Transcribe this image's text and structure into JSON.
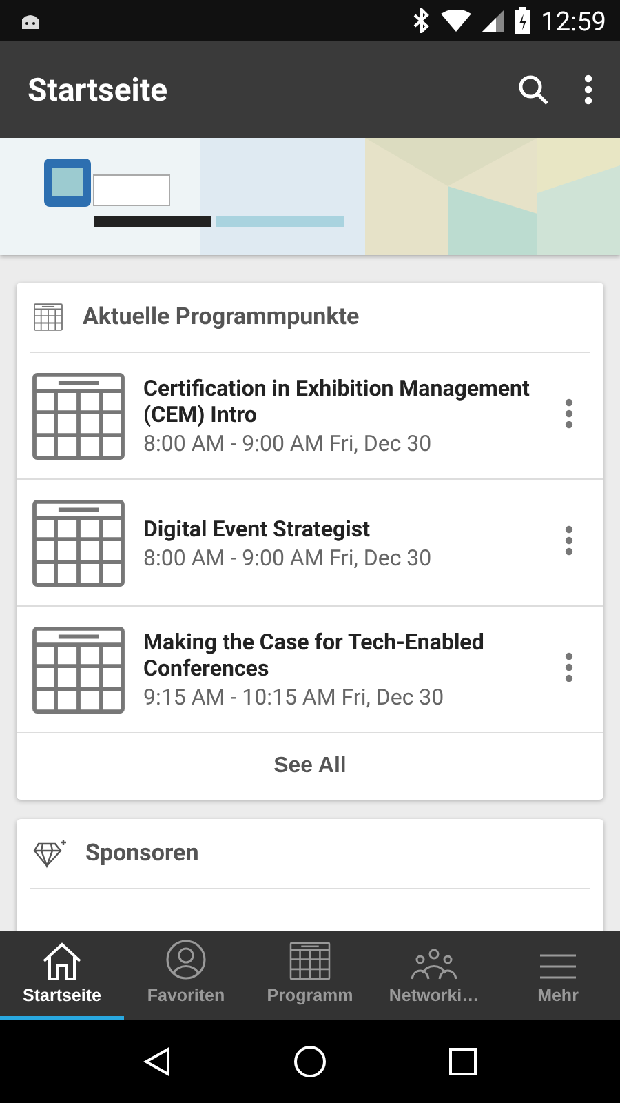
{
  "status_bar": {
    "time": "12:59"
  },
  "app_bar": {
    "title": "Startseite"
  },
  "program_card": {
    "title": "Aktuelle Programmpunkte",
    "sessions": [
      {
        "title": "Certification in Exhibition Management (CEM) Intro",
        "time": "8:00 AM - 9:00 AM Fri, Dec 30"
      },
      {
        "title": "Digital Event Strategist",
        "time": "8:00 AM - 9:00 AM Fri, Dec 30"
      },
      {
        "title": "Making the Case for Tech-Enabled Conferences",
        "time": "9:15 AM - 10:15 AM Fri, Dec 30"
      }
    ],
    "see_all": "See All"
  },
  "sponsors_card": {
    "title": "Sponsoren"
  },
  "bottom_nav": [
    {
      "label": "Startseite",
      "kind": "home",
      "selected": true
    },
    {
      "label": "Favoriten",
      "kind": "person",
      "selected": false
    },
    {
      "label": "Programm",
      "kind": "calendar",
      "selected": false
    },
    {
      "label": "Networki…",
      "kind": "people",
      "selected": false
    },
    {
      "label": "Mehr",
      "kind": "menu",
      "selected": false
    }
  ]
}
